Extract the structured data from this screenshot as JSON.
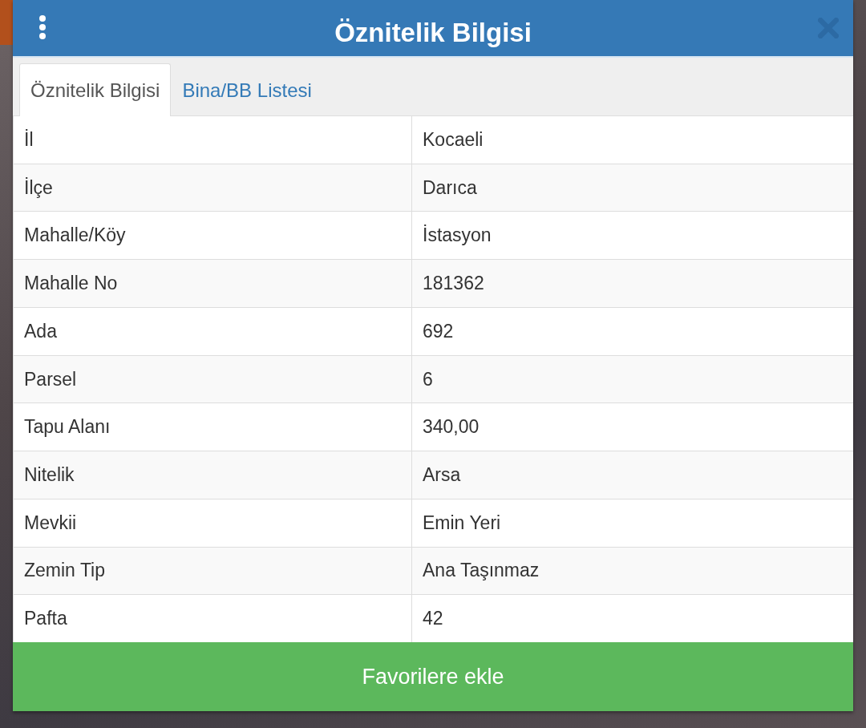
{
  "dialog": {
    "title": "Öznitelik Bilgisi"
  },
  "tabs": [
    {
      "label": "Öznitelik Bilgisi",
      "selected": true
    },
    {
      "label": "Bina/BB Listesi",
      "selected": false
    }
  ],
  "table": {
    "rows": [
      [
        "İl",
        "Kocaeli"
      ],
      [
        "İlçe",
        "Darıca"
      ],
      [
        "Mahalle/Köy",
        "İstasyon"
      ],
      [
        "Mahalle No",
        "181362"
      ],
      [
        "Ada",
        "692"
      ],
      [
        "Parsel",
        "6"
      ],
      [
        "Tapu Alanı",
        "340,00"
      ],
      [
        "Nitelik",
        "Arsa"
      ],
      [
        "Mevkii",
        "Emin Yeri"
      ],
      [
        "Zemin Tip",
        "Ana Taşınmaz"
      ],
      [
        "Pafta",
        "42"
      ]
    ]
  },
  "button": {
    "label": "Favorilere ekle"
  }
}
